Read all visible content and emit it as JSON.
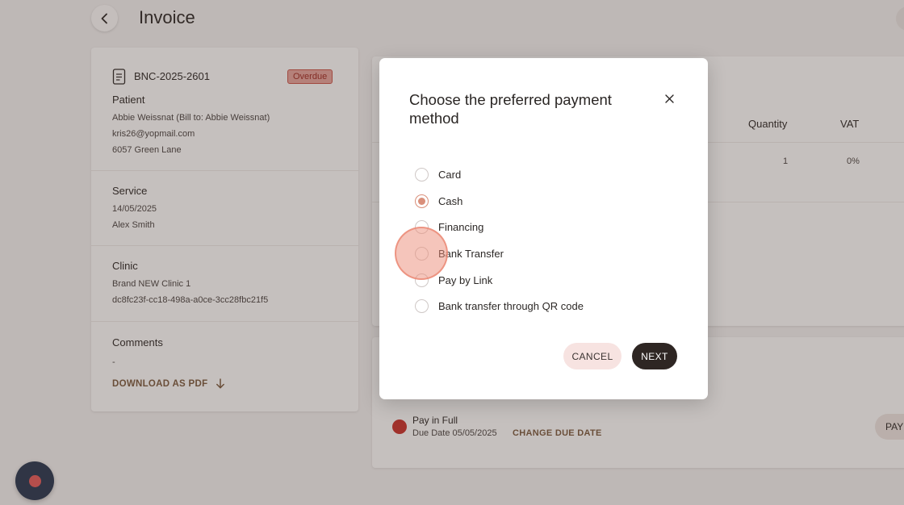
{
  "page": {
    "title": "Invoice"
  },
  "invoice": {
    "number": "BNC-2025-2601",
    "status_badge": "Overdue",
    "patient": {
      "title": "Patient",
      "name": "Abbie Weissnat (Bill to: Abbie Weissnat)",
      "email": "kris26@yopmail.com",
      "address": "6057 Green Lane"
    },
    "service": {
      "title": "Service",
      "date": "14/05/2025",
      "practitioner": "Alex Smith"
    },
    "clinic": {
      "title": "Clinic",
      "name": "Brand NEW Clinic 1",
      "id": "dc8fc23f-cc18-498a-a0ce-3cc28fbc21f5"
    },
    "comments": {
      "title": "Comments",
      "value": "-"
    },
    "download_label": "DOWNLOAD AS PDF"
  },
  "items_table": {
    "columns": [
      "Quantity",
      "VAT"
    ],
    "rows": [
      {
        "quantity": "1",
        "vat": "0%"
      }
    ]
  },
  "payment": {
    "plan": "Pay in Full",
    "due_date": "Due Date 05/05/2025",
    "change_due_label": "CHANGE DUE DATE",
    "pay_label": "PAY"
  },
  "modal": {
    "title": "Choose the preferred payment method",
    "options": [
      {
        "label": "Card",
        "selected": false
      },
      {
        "label": "Cash",
        "selected": true
      },
      {
        "label": "Financing",
        "selected": false
      },
      {
        "label": "Bank Transfer",
        "selected": false
      },
      {
        "label": "Pay by Link",
        "selected": false
      },
      {
        "label": "Bank transfer through QR code",
        "selected": false
      }
    ],
    "cancel_label": "CANCEL",
    "next_label": "NEXT"
  },
  "colors": {
    "accent": "#d98f7a",
    "primary_button": "#2e2623",
    "overdue": "#c9544a",
    "float_button": "#27364f"
  }
}
